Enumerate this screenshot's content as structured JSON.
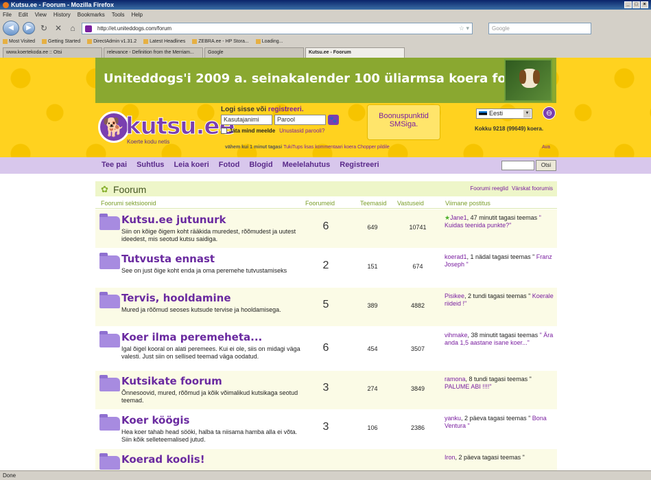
{
  "window": {
    "title": "Kutsu.ee - Foorum - Mozilla Firefox"
  },
  "menu": [
    "File",
    "Edit",
    "View",
    "History",
    "Bookmarks",
    "Tools",
    "Help"
  ],
  "nav": {
    "url": "http://et.uniteddogs.com/forum",
    "search_placeholder": "Google"
  },
  "bookmarks": [
    "Most Visited",
    "Getting Started",
    "DirectAdmin v1.31.2",
    "Latest Headlines",
    "ZEBRA.ee - HP Stora...",
    "Loading..."
  ],
  "tabs": [
    {
      "label": "www.koertekoda.ee :: Otsi"
    },
    {
      "label": "relevance - Definition from the Merriam..."
    },
    {
      "label": "Google"
    },
    {
      "label": "Kutsu.ee - Foorum"
    }
  ],
  "banner": {
    "text": "Uniteddogs'i 2009 a. seinakalender 100 üliarmsa koera fotoga."
  },
  "logo": {
    "word": "kutsu.ee",
    "tagline": "Koerte kodu netis"
  },
  "login": {
    "prefix": "Logi sisse või ",
    "register_link": "registreeri.",
    "username_placeholder": "Kasutajanimi",
    "password_placeholder": "Parool",
    "remember": "Jäta mind meelde",
    "forgot": "Unustasid parooli?"
  },
  "bonus": {
    "line1": "Boonuspunktid",
    "line2": "SMSiga."
  },
  "lang": {
    "selected": "Eesti"
  },
  "stats": {
    "text": "Kokku 9218 (99649) koera."
  },
  "ticker": {
    "bold": "vähem kui 1 minut tagasi",
    "text": "TukiTups lisas kommentaari koera Chopper pildile"
  },
  "ava": "Ava",
  "mainnav": [
    "Tee pai",
    "Suhtlus",
    "Leia koeri",
    "Fotod",
    "Blogid",
    "Meelelahutus",
    "Registreeri"
  ],
  "search_button": "Otsi",
  "forum": {
    "title": "Foorum",
    "links": [
      "Foorumi reeglid",
      "Värskat foorumis"
    ],
    "columns": {
      "section": "Foorumi sektsioonid",
      "forums": "Foorumeid",
      "topics": "Teemasid",
      "replies": "Vastuseid",
      "last_post": "Viimane postitus"
    },
    "rows": [
      {
        "name": "Kutsu.ee jutunurk",
        "desc": "Siin on kõige õigem koht rääkida muredest, rõõmudest ja uutest ideedest, mis seotud kutsu saidiga.",
        "forums": "6",
        "topics": "649",
        "replies": "10741",
        "user": "Jane1",
        "time": ", 47 minutit tagasi teemas ",
        "topic": "\" Kuidas teenida punkte?\"",
        "star": "★"
      },
      {
        "name": "Tutvusta ennast",
        "desc": "See on just õige koht enda ja oma peremehe tutvustamiseks",
        "forums": "2",
        "topics": "151",
        "replies": "674",
        "user": "koerad1",
        "time": ", 1 nädal tagasi teemas \" ",
        "topic": "Franz Joseph \"",
        "star": ""
      },
      {
        "name": "Tervis, hooldamine",
        "desc": "Mured ja rõõmud seoses kutsude tervise ja hooldamisega.",
        "forums": "5",
        "topics": "389",
        "replies": "4882",
        "user": "Pisikee",
        "time": ", 2 tundi tagasi teemas \" ",
        "topic": "Koerale riideid !\"",
        "star": ""
      },
      {
        "name": "Koer ilma peremeheta...",
        "desc": "Igal õigel kooral on alati peremees. Kui ei ole, siis on midagi väga valesti. Just siin on sellised teemad väga oodatud.",
        "forums": "6",
        "topics": "454",
        "replies": "3507",
        "user": "vihmake",
        "time": ", 38 minutit tagasi teemas ",
        "topic": "\" Ära anda 1,5 aastane isane koer...\"",
        "star": ""
      },
      {
        "name": "Kutsikate foorum",
        "desc": "Õnnesoovid, mured, rõõmud ja kõik võimalikud kutsikaga seotud teemad.",
        "forums": "3",
        "topics": "274",
        "replies": "3849",
        "user": "ramona",
        "time": ", 8 tundi tagasi teemas \" ",
        "topic": "PALUME ABI !!!!\"",
        "star": ""
      },
      {
        "name": "Koer köögis",
        "desc": "Hea koer tahab head sööki, halba ta niisama hamba alla ei võta. Siin kõik selleteemalised jutud.",
        "forums": "3",
        "topics": "106",
        "replies": "2386",
        "user": "yanku",
        "time": ", 2 päeva tagasi teemas \" ",
        "topic": "Bona Ventura \"",
        "star": ""
      },
      {
        "name": "Koerad koolis!",
        "desc": "",
        "forums": "",
        "topics": "",
        "replies": "",
        "user": "Iron",
        "time": ", 2 päeva tagasi teemas \"",
        "topic": "",
        "star": ""
      }
    ]
  },
  "status": {
    "text": "Done"
  }
}
